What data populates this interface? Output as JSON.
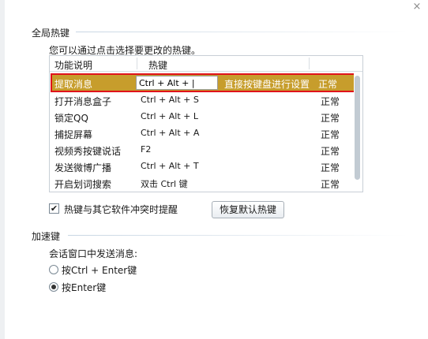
{
  "window": {
    "close_glyph": "×"
  },
  "global_hotkeys": {
    "title": "全局热键",
    "intro": "您可以通过点击选择要更改的热键。",
    "columns": [
      "功能说明",
      "热键"
    ],
    "selected_row": {
      "function": "提取消息",
      "hotkey_value": "Ctrl + Alt + |",
      "hint": "直接按键盘进行设置",
      "status": "正常"
    },
    "rows": [
      {
        "function": "打开消息盒子",
        "hotkey": "Ctrl + Alt + S",
        "status": "正常"
      },
      {
        "function": "锁定QQ",
        "hotkey": "Ctrl + Alt + L",
        "status": "正常"
      },
      {
        "function": "捕捉屏幕",
        "hotkey": "Ctrl + Alt + A",
        "status": "正常"
      },
      {
        "function": "视频秀按键说话",
        "hotkey": "F2",
        "status": "正常"
      },
      {
        "function": "发送微博广播",
        "hotkey": "Ctrl + Alt + T",
        "status": "正常"
      },
      {
        "function": "开启划词搜索",
        "hotkey": "双击 Ctrl 键",
        "status": "正常"
      }
    ],
    "conflict_checkbox": {
      "label": "热键与其它软件冲突时提醒",
      "checked": true,
      "mark": "✔"
    },
    "restore_button": "恢复默认热键"
  },
  "accelerator": {
    "title": "加速键",
    "prompt": "会话窗口中发送消息:",
    "options": [
      {
        "label": "按Ctrl + Enter键",
        "selected": false
      },
      {
        "label": "按Enter键",
        "selected": true
      }
    ]
  },
  "colors": {
    "selected_row_bg": "#c79d2c",
    "selected_row_border": "#e0131b",
    "section_line": "#c8d6e3"
  }
}
